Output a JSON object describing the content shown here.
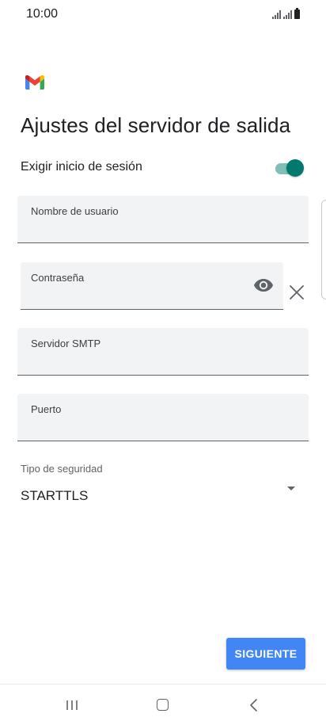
{
  "status_bar": {
    "time": "10:00",
    "icons": [
      "signal-icon",
      "signal-icon",
      "battery-icon"
    ]
  },
  "app": {
    "logo": "gmail-logo-icon",
    "title": "Ajustes del servidor de salida"
  },
  "login_toggle": {
    "label": "Exigir inicio de sesión",
    "enabled": true,
    "accent_color": "#01796f"
  },
  "fields": {
    "username": {
      "label": "Nombre de usuario",
      "value": ""
    },
    "password": {
      "label": "Contraseña",
      "value": "",
      "visibility_icon": "eye-icon",
      "clear_icon": "close-icon"
    },
    "smtp_server": {
      "label": "Servidor SMTP",
      "value": ""
    },
    "port": {
      "label": "Puerto",
      "value": ""
    }
  },
  "security": {
    "label": "Tipo de seguridad",
    "selected": "STARTTLS",
    "icon": "dropdown-arrow-icon"
  },
  "next_button": {
    "label": "SIGUIENTE",
    "color": "#4285f4"
  },
  "nav_bar": {
    "icons": [
      "recent-apps-icon",
      "home-icon",
      "back-icon"
    ]
  }
}
